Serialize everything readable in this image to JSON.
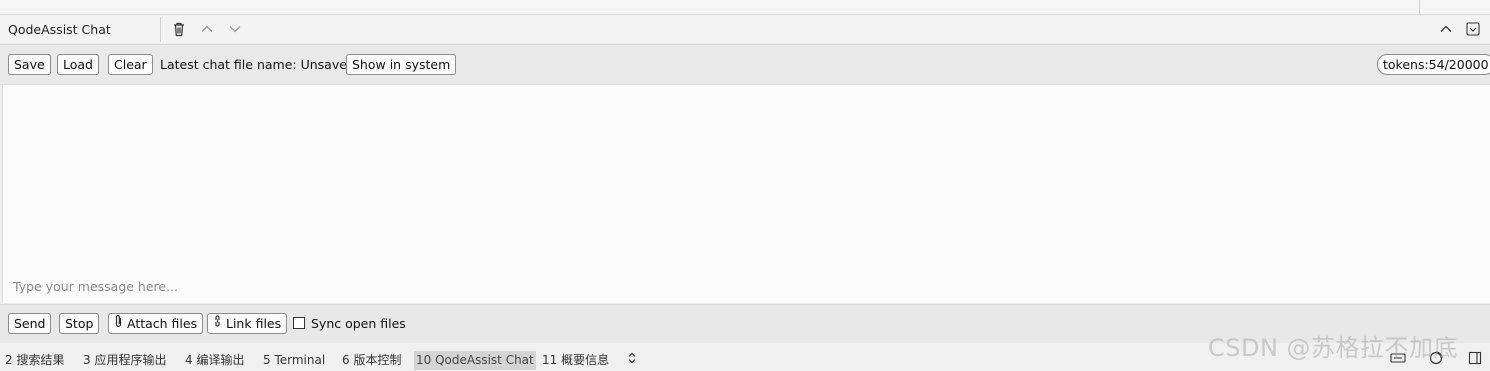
{
  "panel": {
    "title": "QodeAssist Chat",
    "icons": [
      "trash-icon",
      "chevron-up-icon",
      "chevron-down-icon",
      "collapse-up-icon",
      "minimize-icon"
    ]
  },
  "toolbar": {
    "save_label": "Save",
    "load_label": "Load",
    "clear_label": "Clear",
    "file_name_text": "Latest chat file name: Unsaved",
    "show_in_system_label": "Show in system",
    "tokens_text": "tokens:54/20000"
  },
  "input": {
    "placeholder": "Type your message here..."
  },
  "actions": {
    "send_label": "Send",
    "stop_label": "Stop",
    "attach_label": "Attach files",
    "link_label": "Link files",
    "sync_label": "Sync open files",
    "sync_checked": false
  },
  "statusbar": {
    "tabs": [
      {
        "label": "2  搜索结果",
        "active": false
      },
      {
        "label": "3  应用程序输出",
        "active": false
      },
      {
        "label": "4  编译输出",
        "active": false
      },
      {
        "label": "5  Terminal",
        "active": false
      },
      {
        "label": "6  版本控制",
        "active": false
      },
      {
        "label": "10 QodeAssist Chat",
        "active": true
      },
      {
        "label": "11  概要信息",
        "active": false
      }
    ],
    "more_icon": "up-down-arrows-icon"
  },
  "watermark": "CSDN @苏格拉不加底"
}
